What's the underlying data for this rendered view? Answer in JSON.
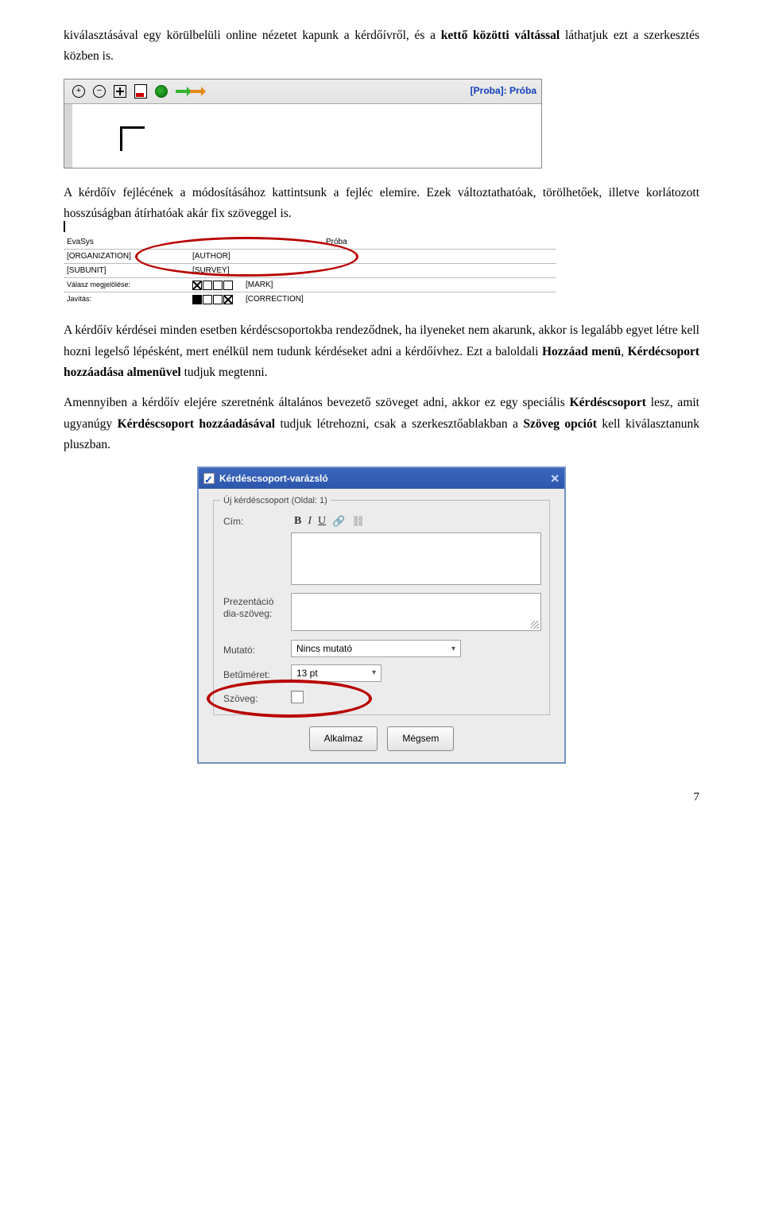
{
  "para1_pre": "kiválasztásával egy körülbelüli online nézetet kapunk a kérdőívről, és a ",
  "para1_bold": "kettő közötti váltással",
  "para1_post": " láthatjuk ezt a szerkesztés közben is.",
  "fig1": {
    "title": "[Proba]: Próba"
  },
  "para2": "A kérdőív fejlécének a módosításához kattintsunk a fejléc elemire. Ezek változtathatóak, törölhetőek, illetve korlátozott hosszúságban átírhatóak akár fix szöveggel is.",
  "fig2": {
    "r1c1": "EvaSys",
    "r1c3": "Próba",
    "r2c1": "[ORGANIZATION]",
    "r2c2": "[AUTHOR]",
    "r3c1": "[SUBUNIT]",
    "r3c2": "[SURVEY]",
    "r4label": "Válasz megjelölése:",
    "r4c2": "[MARK]",
    "r5label": "Javítás:",
    "r5c2": "[CORRECTION]"
  },
  "para3_seg1": "A kérdőív kérdései minden esetben kérdéscsoportokba rendeződnek, ha ilyeneket nem akarunk, akkor is legalább egyet létre kell hozni legelső lépésként, mert enélkül nem tudunk kérdéseket adni a kérdőívhez. Ezt a baloldali ",
  "para3_b1": "Hozzáad menü",
  "para3_seg2": ", ",
  "para3_b2": "Kérdécsoport hozzáadása almenüvel",
  "para3_seg3": " tudjuk megtenni.",
  "para4_seg1": "Amennyiben a kérdőív elejére szeretnénk általános bevezető szöveget adni, akkor ez egy speciális ",
  "para4_b1": "Kérdéscsoport",
  "para4_seg2": " lesz, amit ugyanúgy ",
  "para4_b2": "Kérdéscsoport hozzáadásával",
  "para4_seg3": " tudjuk létrehozni, csak a szerkesztőablakban a ",
  "para4_b3": "Szöveg opciót",
  "para4_seg4": " kell kiválasztanunk pluszban.",
  "fig3": {
    "title": "Kérdéscsoport-varázsló",
    "legend": "Új kérdéscsoport (Oldal: 1)",
    "label_cim": "Cím:",
    "label_pres": "Prezentáció dia-szöveg:",
    "label_mutato": "Mutató:",
    "mutato_value": "Nincs mutató",
    "label_betumeret": "Betűméret:",
    "betumeret_value": "13 pt",
    "label_szoveg": "Szöveg:",
    "btn_apply": "Alkalmaz",
    "btn_cancel": "Mégsem"
  },
  "page_number": "7"
}
